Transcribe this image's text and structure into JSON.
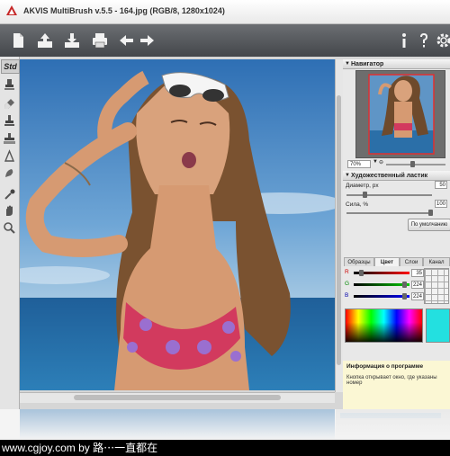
{
  "window": {
    "title": "AKVIS MultiBrush v.5.5 - 164.jpg (RGB/8, 1280x1024)"
  },
  "toolbar": {
    "left": [
      {
        "name": "new-file-icon"
      },
      {
        "name": "open-icon"
      },
      {
        "name": "save-icon"
      },
      {
        "name": "print-icon"
      },
      {
        "name": "undo-arrow-icon"
      },
      {
        "name": "redo-arrow-icon"
      }
    ],
    "right": [
      {
        "name": "info-icon"
      },
      {
        "name": "help-icon"
      },
      {
        "name": "settings-gear-icon"
      }
    ]
  },
  "tools": {
    "mode_label": "Std",
    "items": [
      "clone-stamp-icon",
      "eraser-icon",
      "stamp-icon",
      "stamp-alt-icon",
      "blur-icon",
      "smudge-icon",
      "eyedropper-icon",
      "hand-icon",
      "zoom-icon"
    ]
  },
  "navigator": {
    "header": "Навигатор",
    "zoom": "70%"
  },
  "brush": {
    "header": "Художественный ластик",
    "diameter_label": "Диаметр, px",
    "diameter_value": "50",
    "strength_label": "Сила, %",
    "strength_value": "100",
    "default_button": "По умолчанию"
  },
  "color": {
    "tabs": [
      "Образцы",
      "Цвет",
      "Слои",
      "Канал"
    ],
    "active_tab": "Цвет",
    "channels": [
      {
        "label": "R",
        "value": "35"
      },
      {
        "label": "G",
        "value": "224"
      },
      {
        "label": "B",
        "value": "224"
      }
    ],
    "current_color": "#23e0e0"
  },
  "info": {
    "header": "Информация о программе",
    "text": "Кнопка открывает окно, где указаны номер"
  },
  "footer": {
    "text": "www.cgjoy.com by 路⋯一直都在"
  }
}
